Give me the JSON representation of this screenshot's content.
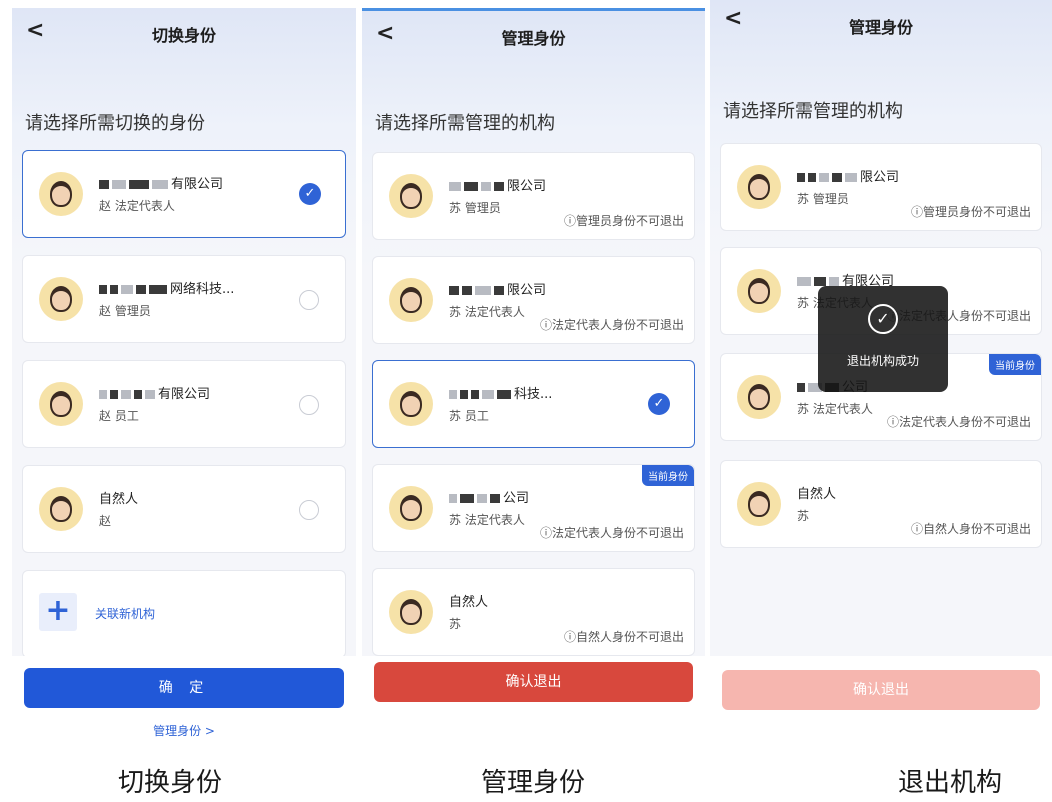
{
  "screen1": {
    "back_label": "<",
    "title": "切换身份",
    "prompt": "请选择所需切换的身份",
    "cards": [
      {
        "org": "有限公司",
        "role": "赵 法定代表人",
        "selected": true
      },
      {
        "org": "网络科技...",
        "role": "赵 管理员",
        "selected": false
      },
      {
        "org": "有限公司",
        "role": "赵 员工",
        "selected": false
      },
      {
        "org": "自然人",
        "role": "赵",
        "selected": false
      }
    ],
    "add_label": "关联新机构",
    "add_icon": "plus-icon",
    "confirm_label": "确 定",
    "manage_link": "管理身份 >"
  },
  "screen2": {
    "back_label": "<",
    "title": "管理身份",
    "prompt": "请选择所需管理的机构",
    "cards": [
      {
        "org": "限公司",
        "role": "苏 管理员",
        "note": "ⓘ管理员身份不可退出"
      },
      {
        "org": "限公司",
        "role": "苏 法定代表人",
        "note": "ⓘ法定代表人身份不可退出"
      },
      {
        "org": "科技...",
        "role": "苏 员工",
        "selected": true
      },
      {
        "org": "公司",
        "role": "苏 法定代表人",
        "note": "ⓘ法定代表人身份不可退出",
        "badge": "当前身份"
      },
      {
        "org": "自然人",
        "role": "苏",
        "note": "ⓘ自然人身份不可退出"
      }
    ],
    "exit_label": "确认退出"
  },
  "screen3": {
    "back_label": "<",
    "title": "管理身份",
    "prompt": "请选择所需管理的机构",
    "cards": [
      {
        "org": "限公司",
        "role": "苏 管理员",
        "note": "ⓘ管理员身份不可退出"
      },
      {
        "org": "有限公司",
        "role": "苏 法定代表人",
        "note": "ⓘ法定代表人身份不可退出"
      },
      {
        "org": "公司",
        "role": "苏 法定代表人",
        "note": "ⓘ法定代表人身份不可退出",
        "badge": "当前身份"
      },
      {
        "org": "自然人",
        "role": "苏",
        "note": "ⓘ自然人身份不可退出"
      }
    ],
    "toast": "退出机构成功",
    "exit_label": "确认退出"
  },
  "captions": [
    "切换身份",
    "管理身份",
    "退出机构"
  ],
  "colors": {
    "primary": "#2158d8",
    "danger": "#d8483d",
    "danger_disabled": "#f6b6af"
  }
}
